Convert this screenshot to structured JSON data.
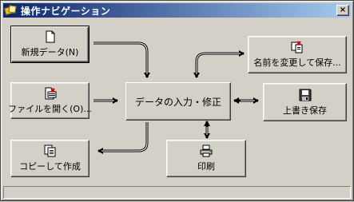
{
  "window": {
    "title": "操作ナビゲーション",
    "close_glyph": "×"
  },
  "buttons": {
    "new_data": "新規データ(N)",
    "open_file": "ファイルを開く(O)...",
    "copy_create": "コピーして作成",
    "save_as": "名前を変更して保存...",
    "overwrite_save": "上書き保存",
    "print": "印刷"
  },
  "center": {
    "label": "データの入力・修正"
  },
  "colors": {
    "face": "#d4d0c8",
    "title_start": "#0a246a",
    "title_end": "#a6caf0"
  },
  "icons": [
    "app-icon",
    "new-document-icon",
    "open-file-icon",
    "copy-documents-icon",
    "save-as-icon",
    "floppy-disk-icon",
    "printer-icon"
  ]
}
